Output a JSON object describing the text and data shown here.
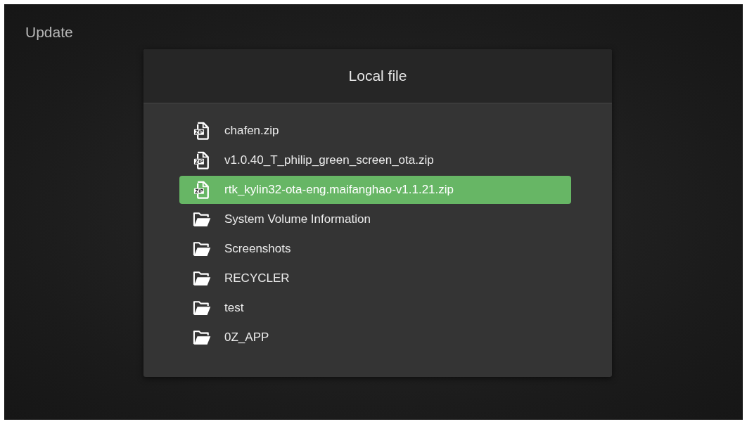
{
  "screen": {
    "title": "Update"
  },
  "dialog": {
    "title": "Local file",
    "files": [
      {
        "kind": "zip",
        "name": "chafen.zip",
        "selected": false
      },
      {
        "kind": "zip",
        "name": "v1.0.40_T_philip_green_screen_ota.zip",
        "selected": false
      },
      {
        "kind": "zip",
        "name": "rtk_kylin32-ota-eng.maifanghao-v1.1.21.zip",
        "selected": true
      },
      {
        "kind": "folder",
        "name": "System Volume Information",
        "selected": false
      },
      {
        "kind": "folder",
        "name": "Screenshots",
        "selected": false
      },
      {
        "kind": "folder",
        "name": "RECYCLER",
        "selected": false
      },
      {
        "kind": "folder",
        "name": "test",
        "selected": false
      },
      {
        "kind": "folder",
        "name": "0Z_APP",
        "selected": false
      }
    ]
  }
}
